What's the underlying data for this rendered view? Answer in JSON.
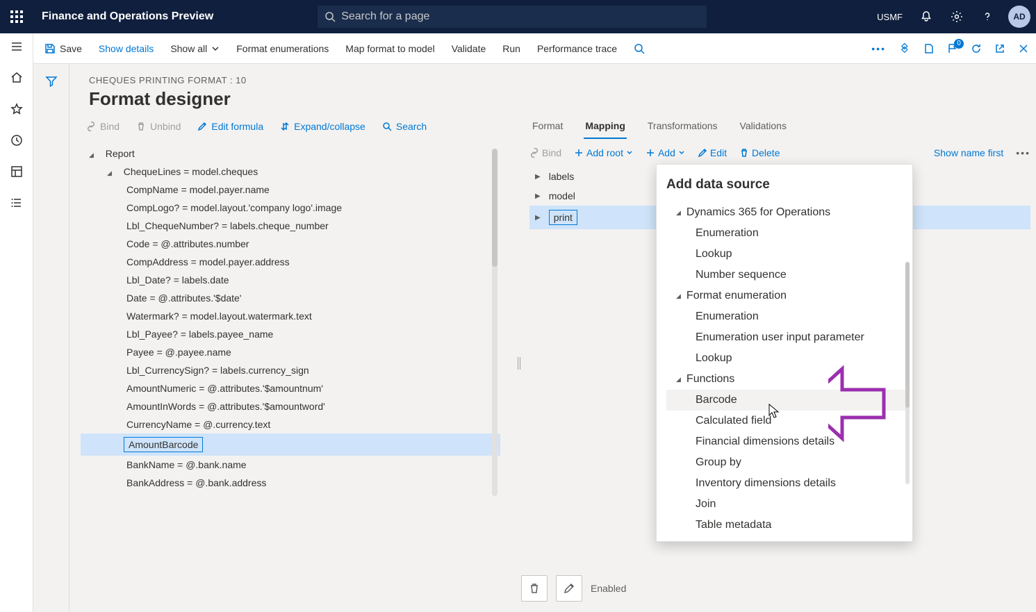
{
  "top": {
    "app_title": "Finance and Operations Preview",
    "search_placeholder": "Search for a page",
    "company": "USMF",
    "avatar_initials": "AD",
    "badge_count": "0"
  },
  "cmd": {
    "save": "Save",
    "show_details": "Show details",
    "show_all": "Show all",
    "format_enum": "Format enumerations",
    "map": "Map format to model",
    "validate": "Validate",
    "run": "Run",
    "perf": "Performance trace"
  },
  "page": {
    "breadcrumb": "CHEQUES PRINTING FORMAT : 10",
    "title": "Format designer"
  },
  "lefttool": {
    "bind": "Bind",
    "unbind": "Unbind",
    "edit_formula": "Edit formula",
    "expand": "Expand/collapse",
    "search": "Search"
  },
  "tree": {
    "root": "Report",
    "cheque_lines": "ChequeLines = model.cheques",
    "items": [
      "CompName = model.payer.name",
      "CompLogo? = model.layout.'company logo'.image",
      "Lbl_ChequeNumber? = labels.cheque_number",
      "Code = @.attributes.number",
      "CompAddress = model.payer.address",
      "Lbl_Date? = labels.date",
      "Date = @.attributes.'$date'",
      "Watermark? = model.layout.watermark.text",
      "Lbl_Payee? = labels.payee_name",
      "Payee = @.payee.name",
      "Lbl_CurrencySign? = labels.currency_sign",
      "AmountNumeric = @.attributes.'$amountnum'",
      "AmountInWords = @.attributes.'$amountword'",
      "CurrencyName = @.currency.text"
    ],
    "selected": "AmountBarcode",
    "after": [
      "BankName = @.bank.name",
      "BankAddress = @.bank.address"
    ]
  },
  "right_tabs": {
    "format": "Format",
    "mapping": "Mapping",
    "transformations": "Transformations",
    "validations": "Validations"
  },
  "rtool": {
    "bind": "Bind",
    "add_root": "Add root",
    "add": "Add",
    "edit": "Edit",
    "delete": "Delete",
    "show_name_first": "Show name first"
  },
  "ds": {
    "labels": "labels",
    "model": "model",
    "print": "print"
  },
  "popup": {
    "title": "Add data source",
    "d365": "Dynamics 365 for Operations",
    "d365_items": [
      "Enumeration",
      "Lookup",
      "Number sequence"
    ],
    "fenum": "Format enumeration",
    "fenum_items": [
      "Enumeration",
      "Enumeration user input parameter",
      "Lookup"
    ],
    "functions": "Functions",
    "functions_items": [
      "Barcode",
      "Calculated field",
      "Financial dimensions details",
      "Group by",
      "Inventory dimensions details",
      "Join",
      "Table metadata"
    ]
  },
  "status": {
    "enabled": "Enabled"
  }
}
